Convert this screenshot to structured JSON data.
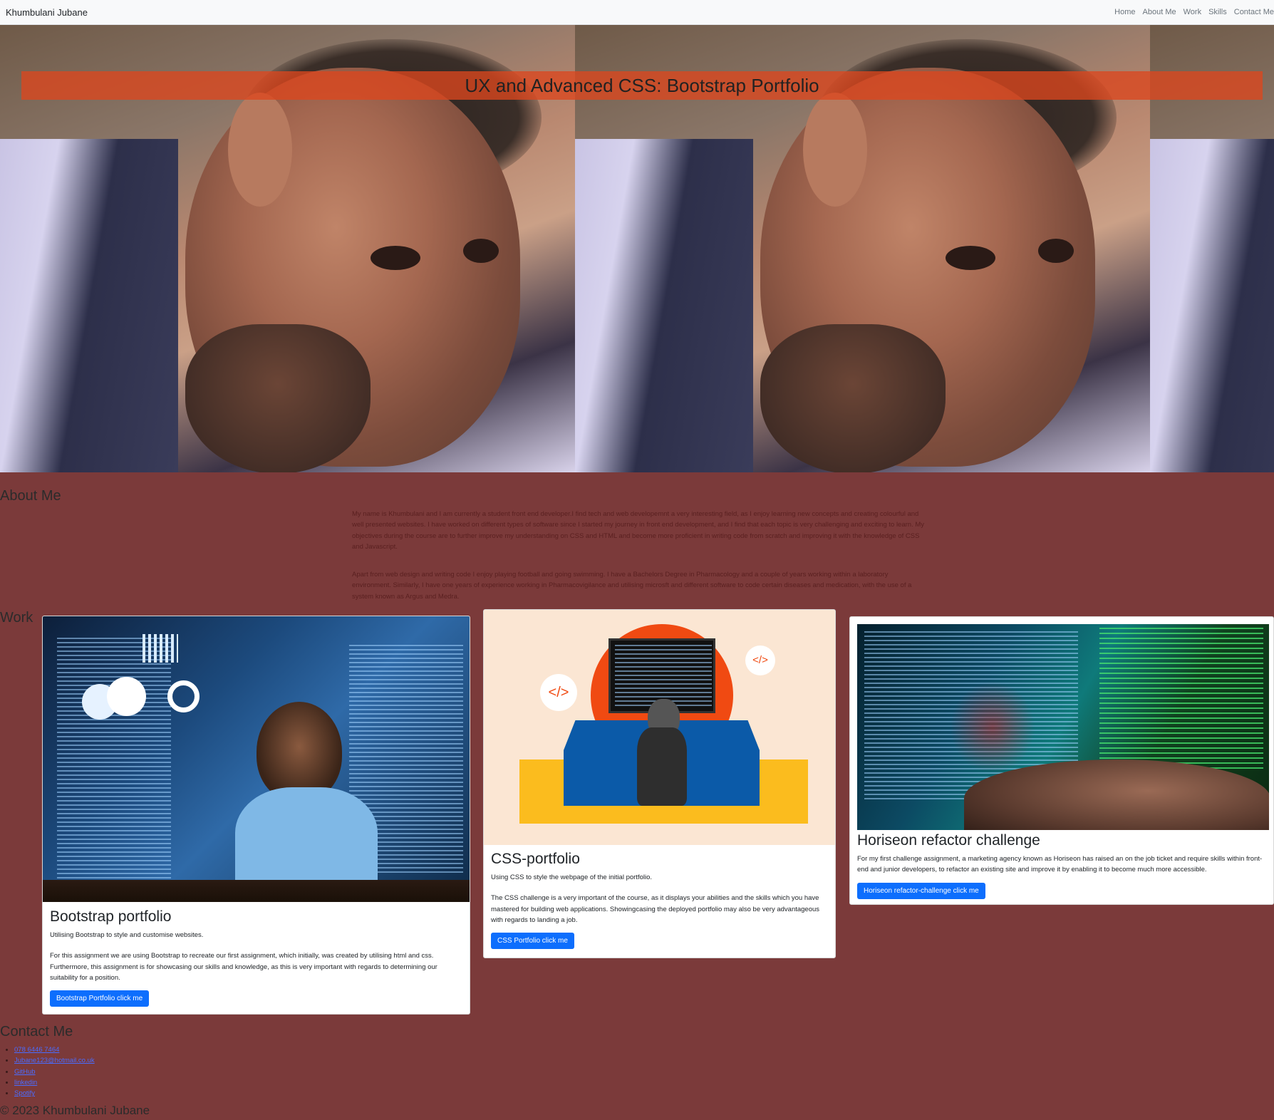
{
  "nav": {
    "brand": "Khumbulani Jubane",
    "links": [
      "Home",
      "About Me",
      "Work",
      "Skills",
      "Contact Me"
    ]
  },
  "hero": {
    "title": "UX and Advanced CSS: Bootstrap Portfolio"
  },
  "about": {
    "heading": "About Me",
    "paragraphs": [
      "My name is Khumbulani and I am currently a student front end developer.I find tech and web developemnt a very interesting field, as I enjoy learning new concepts and creating colourful and well presented websites. I have worked on different types of software since I started my journey in front end development, and I find that each topic is very challenging and exciting to learn. My objectives during the course are to further improve my understanding on CSS and HTML and become more proficient in writing code from scratch and improving it with the knowledge of CSS and Javascript.",
      "Apart from web design and writing code I enjoy playing football and going swimming. I have a Bachelors Degree in Pharmacology and a couple of years working within a laboratory environment. Similarly, I have one years of experience working in Pharmacovigilance and utilising microsft and different software to code certain diseases and medication, with the use of a system known as Argus and Medra."
    ]
  },
  "work": {
    "heading": "Work",
    "cards": [
      {
        "title": "Bootstrap portfolio",
        "subtitle": "Utilising Bootstrap to style and customise websites.",
        "text": "For this assignment we are using Bootstrap to recreate our first assignment, which initially, was created by utilising html and css. Furthermore, this assignment is for showcasing our skills and knowledge, as this is very important with regards to determining our suitability for a position.",
        "button": "Bootstrap Portfolio click me"
      },
      {
        "title": "CSS-portfolio",
        "subtitle": "Using CSS to style the webpage of the initial portfolio.",
        "text": "The CSS challenge is a very important of the course, as it displays your abilities and the skills which you have mastered for building web applications. Showingcasing the deployed portfolio may also be very advantageous with regards to landing a job.",
        "button": "CSS Portfolio click me"
      },
      {
        "title": "Horiseon refactor challenge",
        "text": "For my first challenge assignment, a marketing agency known as Horiseon has raised an on the job ticket and require skills within front-end and junior developers, to refactor an existing site and improve it by enabling it to become much more accessible.",
        "button": "Horiseon refactor-challenge click me"
      }
    ]
  },
  "contact": {
    "heading": "Contact Me",
    "links": [
      "078 6446 7464",
      "Jubane123@hotmail.co.uk",
      "GitHub",
      "linkedin",
      "Spotify"
    ]
  },
  "footer": {
    "text": "© 2023 Khumbulani Jubane"
  },
  "colors": {
    "page_background": "#7b3a3a",
    "banner": "#dc461e",
    "button": "#0d6efd"
  }
}
